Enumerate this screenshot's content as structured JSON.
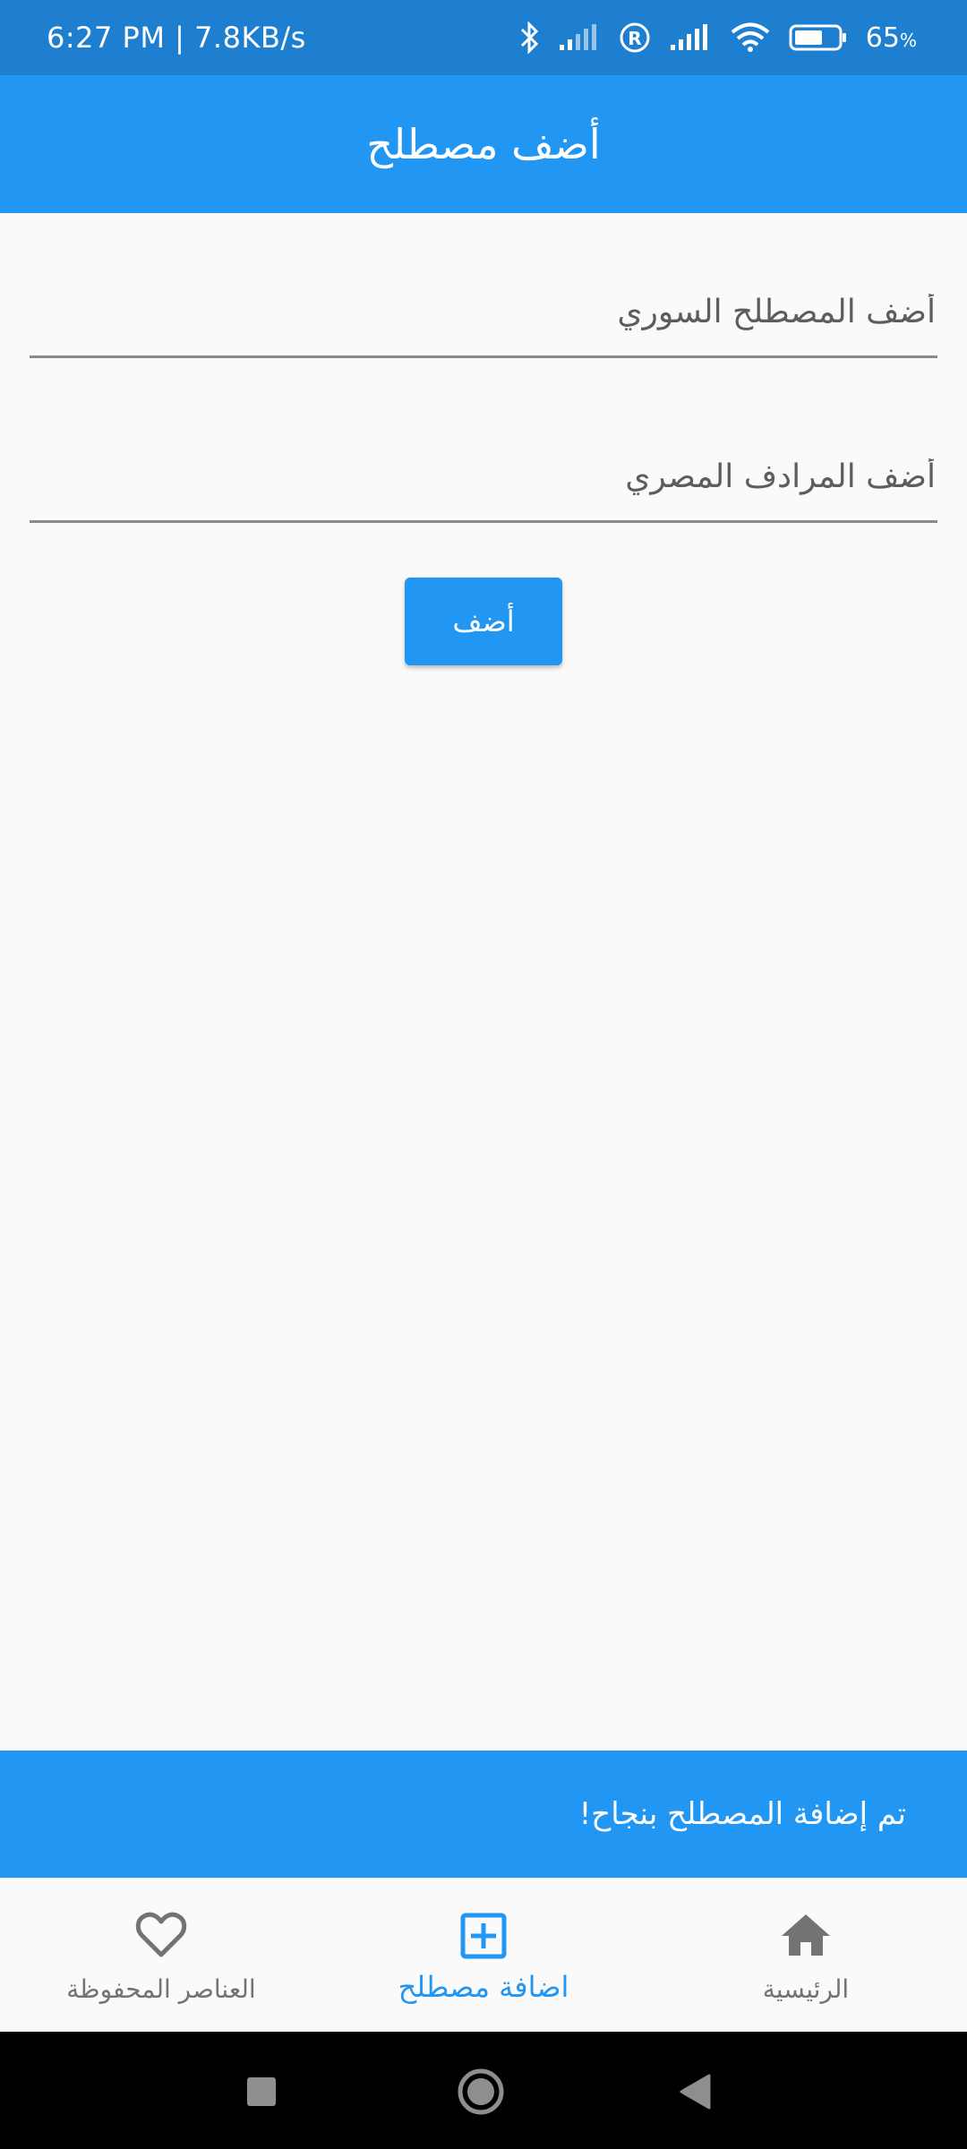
{
  "status_bar": {
    "time_speed": "6:27 PM | 7.8KB/s",
    "battery_percent": "65",
    "battery_unit": "%",
    "battery_level": 0.65,
    "icons": [
      "bluetooth-icon",
      "signal-icon",
      "roaming-icon",
      "signal-icon",
      "wifi-icon",
      "battery-icon"
    ]
  },
  "app_bar": {
    "title": "أضف مصطلح"
  },
  "form": {
    "syrian_term_placeholder": "أضف المصطلح السوري",
    "syrian_term_value": "",
    "egyptian_synonym_placeholder": "أضف المرادف المصري",
    "egyptian_synonym_value": "",
    "add_button_label": "أضف"
  },
  "snackbar": {
    "message": "تم إضافة المصطلح بنجاح!"
  },
  "bottom_nav": {
    "items": [
      {
        "label": "العناصر المحفوظة",
        "icon": "heart-outline-icon",
        "active": false
      },
      {
        "label": "اضافة مصطلح",
        "icon": "add-box-icon",
        "active": true
      },
      {
        "label": "الرئيسية",
        "icon": "home-icon",
        "active": false
      }
    ]
  },
  "system_nav": {
    "icons": [
      "recents-icon",
      "home-circle-icon",
      "back-icon"
    ]
  },
  "colors": {
    "primary": "#2196f3",
    "status_bar": "#1e7fd0",
    "background": "#fafafa",
    "inactive": "#737373"
  }
}
